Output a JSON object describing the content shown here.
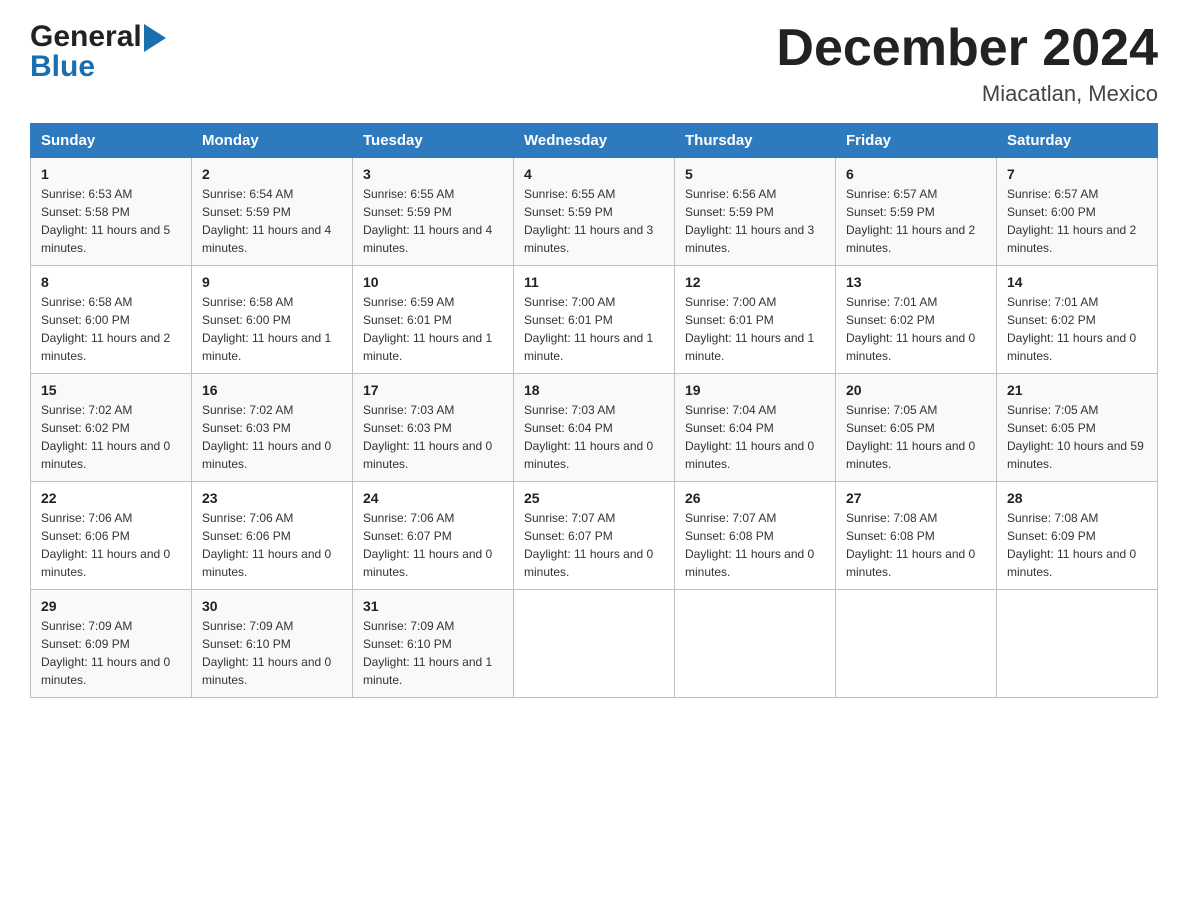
{
  "header": {
    "logo_general": "General",
    "logo_blue": "Blue",
    "title": "December 2024",
    "location": "Miacatlan, Mexico"
  },
  "days_of_week": [
    "Sunday",
    "Monday",
    "Tuesday",
    "Wednesday",
    "Thursday",
    "Friday",
    "Saturday"
  ],
  "weeks": [
    [
      {
        "day": "1",
        "sunrise": "6:53 AM",
        "sunset": "5:58 PM",
        "daylight": "11 hours and 5 minutes."
      },
      {
        "day": "2",
        "sunrise": "6:54 AM",
        "sunset": "5:59 PM",
        "daylight": "11 hours and 4 minutes."
      },
      {
        "day": "3",
        "sunrise": "6:55 AM",
        "sunset": "5:59 PM",
        "daylight": "11 hours and 4 minutes."
      },
      {
        "day": "4",
        "sunrise": "6:55 AM",
        "sunset": "5:59 PM",
        "daylight": "11 hours and 3 minutes."
      },
      {
        "day": "5",
        "sunrise": "6:56 AM",
        "sunset": "5:59 PM",
        "daylight": "11 hours and 3 minutes."
      },
      {
        "day": "6",
        "sunrise": "6:57 AM",
        "sunset": "5:59 PM",
        "daylight": "11 hours and 2 minutes."
      },
      {
        "day": "7",
        "sunrise": "6:57 AM",
        "sunset": "6:00 PM",
        "daylight": "11 hours and 2 minutes."
      }
    ],
    [
      {
        "day": "8",
        "sunrise": "6:58 AM",
        "sunset": "6:00 PM",
        "daylight": "11 hours and 2 minutes."
      },
      {
        "day": "9",
        "sunrise": "6:58 AM",
        "sunset": "6:00 PM",
        "daylight": "11 hours and 1 minute."
      },
      {
        "day": "10",
        "sunrise": "6:59 AM",
        "sunset": "6:01 PM",
        "daylight": "11 hours and 1 minute."
      },
      {
        "day": "11",
        "sunrise": "7:00 AM",
        "sunset": "6:01 PM",
        "daylight": "11 hours and 1 minute."
      },
      {
        "day": "12",
        "sunrise": "7:00 AM",
        "sunset": "6:01 PM",
        "daylight": "11 hours and 1 minute."
      },
      {
        "day": "13",
        "sunrise": "7:01 AM",
        "sunset": "6:02 PM",
        "daylight": "11 hours and 0 minutes."
      },
      {
        "day": "14",
        "sunrise": "7:01 AM",
        "sunset": "6:02 PM",
        "daylight": "11 hours and 0 minutes."
      }
    ],
    [
      {
        "day": "15",
        "sunrise": "7:02 AM",
        "sunset": "6:02 PM",
        "daylight": "11 hours and 0 minutes."
      },
      {
        "day": "16",
        "sunrise": "7:02 AM",
        "sunset": "6:03 PM",
        "daylight": "11 hours and 0 minutes."
      },
      {
        "day": "17",
        "sunrise": "7:03 AM",
        "sunset": "6:03 PM",
        "daylight": "11 hours and 0 minutes."
      },
      {
        "day": "18",
        "sunrise": "7:03 AM",
        "sunset": "6:04 PM",
        "daylight": "11 hours and 0 minutes."
      },
      {
        "day": "19",
        "sunrise": "7:04 AM",
        "sunset": "6:04 PM",
        "daylight": "11 hours and 0 minutes."
      },
      {
        "day": "20",
        "sunrise": "7:05 AM",
        "sunset": "6:05 PM",
        "daylight": "11 hours and 0 minutes."
      },
      {
        "day": "21",
        "sunrise": "7:05 AM",
        "sunset": "6:05 PM",
        "daylight": "10 hours and 59 minutes."
      }
    ],
    [
      {
        "day": "22",
        "sunrise": "7:06 AM",
        "sunset": "6:06 PM",
        "daylight": "11 hours and 0 minutes."
      },
      {
        "day": "23",
        "sunrise": "7:06 AM",
        "sunset": "6:06 PM",
        "daylight": "11 hours and 0 minutes."
      },
      {
        "day": "24",
        "sunrise": "7:06 AM",
        "sunset": "6:07 PM",
        "daylight": "11 hours and 0 minutes."
      },
      {
        "day": "25",
        "sunrise": "7:07 AM",
        "sunset": "6:07 PM",
        "daylight": "11 hours and 0 minutes."
      },
      {
        "day": "26",
        "sunrise": "7:07 AM",
        "sunset": "6:08 PM",
        "daylight": "11 hours and 0 minutes."
      },
      {
        "day": "27",
        "sunrise": "7:08 AM",
        "sunset": "6:08 PM",
        "daylight": "11 hours and 0 minutes."
      },
      {
        "day": "28",
        "sunrise": "7:08 AM",
        "sunset": "6:09 PM",
        "daylight": "11 hours and 0 minutes."
      }
    ],
    [
      {
        "day": "29",
        "sunrise": "7:09 AM",
        "sunset": "6:09 PM",
        "daylight": "11 hours and 0 minutes."
      },
      {
        "day": "30",
        "sunrise": "7:09 AM",
        "sunset": "6:10 PM",
        "daylight": "11 hours and 0 minutes."
      },
      {
        "day": "31",
        "sunrise": "7:09 AM",
        "sunset": "6:10 PM",
        "daylight": "11 hours and 1 minute."
      },
      null,
      null,
      null,
      null
    ]
  ]
}
